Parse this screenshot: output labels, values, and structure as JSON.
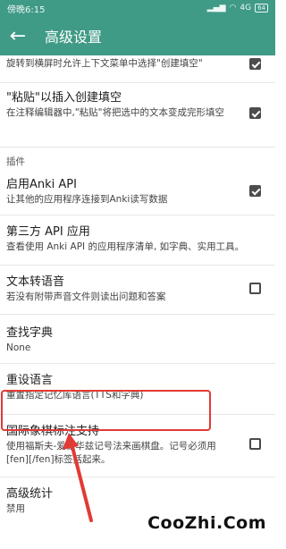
{
  "status_bar": {
    "time": "傍晚6:15",
    "icons_text": "4G",
    "battery": "64"
  },
  "toolbar": {
    "back_icon": "arrow-back-icon",
    "title": "高级设置"
  },
  "rows": [
    {
      "title": "",
      "subtitle": "旋转到横屏时允许上下文菜单中选择\"创建填空\"",
      "checked": true
    },
    {
      "title": "\"粘贴\"以插入创建填空",
      "subtitle": "在注释编辑器中,\"粘贴\"将把选中的文本变成完形填空",
      "checked": true
    },
    {
      "section": "插件"
    },
    {
      "title": "启用Anki API",
      "subtitle": "让其他的应用程序连接到Anki读写数据",
      "checked": true
    },
    {
      "title": "第三方 API 应用",
      "subtitle": "查看使用 Anki API 的应用程序清单, 如字典、实用工具。"
    },
    {
      "title": "文本转语音",
      "subtitle": "若没有附带声音文件则读出问题和答案",
      "checked": false
    },
    {
      "title": "查找字典",
      "subtitle": "None"
    },
    {
      "title": "重设语言",
      "subtitle": "重置指定记忆库语言(TTS和字典)"
    },
    {
      "title": "国际象棋标注支持",
      "subtitle": "使用福斯夫-爱德华兹记号法来画棋盘。记号必须用[fen][/fen]标签括起来。",
      "checked": false
    },
    {
      "title": "高级统计",
      "subtitle": "禁用"
    }
  ],
  "colors": {
    "toolbar": "#3f9a86",
    "highlight": "#e23a34"
  },
  "watermark": "CooZhi.Com"
}
